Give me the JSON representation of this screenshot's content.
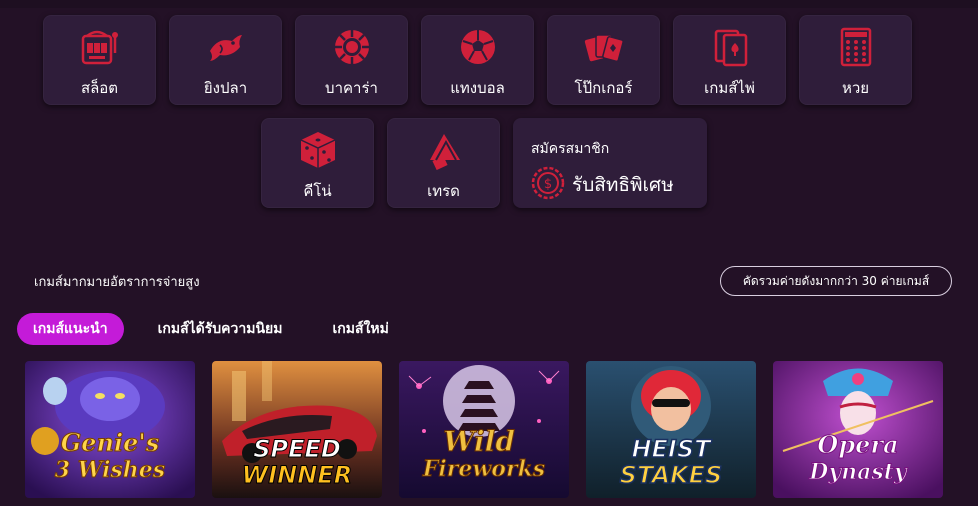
{
  "categories_row1": [
    {
      "label": "สล็อต",
      "icon": "slot-machine-icon"
    },
    {
      "label": "ยิงปลา",
      "icon": "fish-icon"
    },
    {
      "label": "บาคาร่า",
      "icon": "poker-chip-icon"
    },
    {
      "label": "แทงบอล",
      "icon": "soccer-ball-icon"
    },
    {
      "label": "โป๊กเกอร์",
      "icon": "playing-cards-icon"
    },
    {
      "label": "เกมส์ไพ่",
      "icon": "card-game-icon"
    },
    {
      "label": "หวย",
      "icon": "lotto-ticket-icon"
    }
  ],
  "categories_row2": [
    {
      "label": "คีโน่",
      "icon": "dice-icon"
    },
    {
      "label": "เทรด",
      "icon": "trade-chart-icon"
    }
  ],
  "signup": {
    "small_text": "สมัครสมาชิก",
    "big_text": "รับสิทธิพิเศษ",
    "icon": "coin-icon"
  },
  "section": {
    "title": "เกมส์มากมายอัตราการจ่ายสูง",
    "link_text": "คัดรวมค่ายดังมากกว่า 30 ค่ายเกมส์"
  },
  "tabs": [
    {
      "label": "เกมส์แนะนำ",
      "active": true
    },
    {
      "label": "เกมส์ได้รับความนิยม",
      "active": false
    },
    {
      "label": "เกมส์ใหม่",
      "active": false
    }
  ],
  "games": [
    {
      "title_line1": "Genie's",
      "title_line2": "3 Wishes"
    },
    {
      "title_line1": "SPEED",
      "title_line2": "WINNER"
    },
    {
      "title_line1": "Wild",
      "title_line2": "Fireworks"
    },
    {
      "title_line1": "HEIST",
      "title_line2": "STAKES"
    },
    {
      "title_line1": "Opera",
      "title_line2": "Dynasty"
    }
  ],
  "colors": {
    "background": "#231126",
    "card": "#2f1d3a",
    "icon_red": "#d0203a",
    "active_tab": "#c41bd8"
  }
}
